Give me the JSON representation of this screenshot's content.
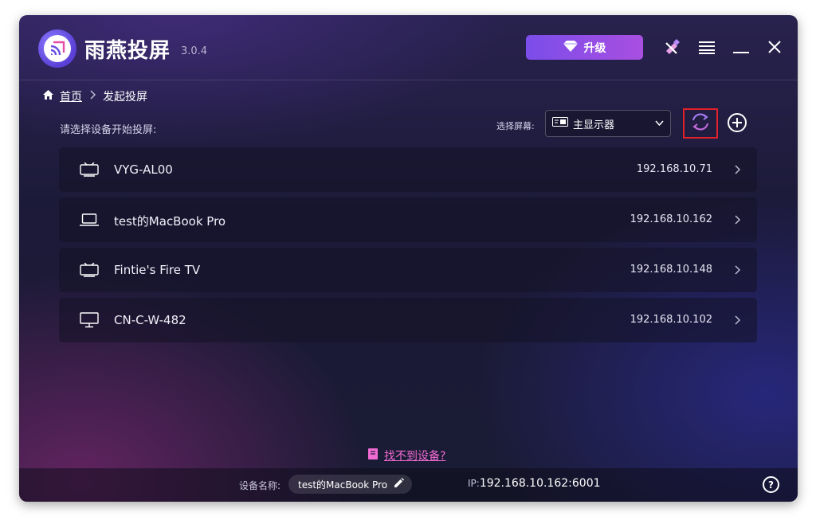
{
  "app": {
    "name": "雨燕投屏",
    "version": "3.0.4",
    "upgrade_label": "升级"
  },
  "breadcrumb": {
    "home": "首页",
    "current": "发起投屏"
  },
  "prompt": "请选择设备开始投屏:",
  "screen_select": {
    "label": "选择屏幕:",
    "value": "主显示器"
  },
  "devices": [
    {
      "name": "VYG-AL00",
      "ip": "192.168.10.71",
      "icon": "tv-icon"
    },
    {
      "name": "test的MacBook Pro",
      "ip": "192.168.10.162",
      "icon": "laptop-icon"
    },
    {
      "name": "Fintie's Fire TV",
      "ip": "192.168.10.148",
      "icon": "tv-icon"
    },
    {
      "name": "CN-C-W-482",
      "ip": "192.168.10.102",
      "icon": "monitor-icon"
    }
  ],
  "help_link": "找不到设备?",
  "footer": {
    "device_label": "设备名称:",
    "device_name": "test的MacBook Pro",
    "ip_prefix": "IP:",
    "ip": "192.168.10.162:6001",
    "help_icon": "?"
  },
  "colors": {
    "accent": "#7b4dea",
    "link": "#f06bd2",
    "highlight_box": "#e0212a"
  }
}
